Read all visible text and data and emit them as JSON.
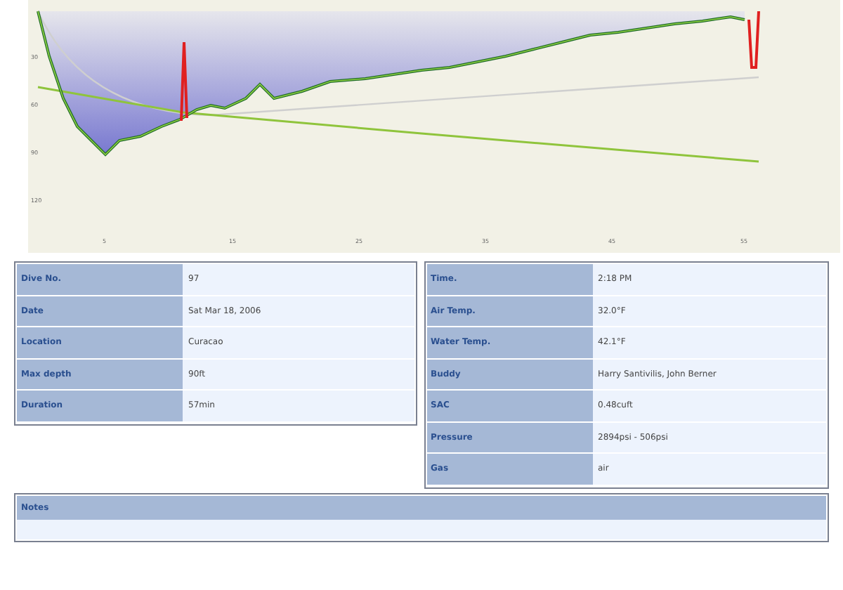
{
  "profile": {
    "y_ticks": [
      "30",
      "60",
      "90",
      "120"
    ],
    "x_ticks": [
      "5",
      "15",
      "25",
      "35",
      "45",
      "55"
    ]
  },
  "left_table": [
    {
      "label": "Dive No.",
      "value": "97"
    },
    {
      "label": "Date",
      "value": "Sat Mar 18, 2006"
    },
    {
      "label": "Location",
      "value": "Curacao"
    },
    {
      "label": "Max depth",
      "value": "90ft"
    },
    {
      "label": "Duration",
      "value": "57min"
    }
  ],
  "right_table": [
    {
      "label": "Time.",
      "value": "2:18 PM"
    },
    {
      "label": "Air Temp.",
      "value": "32.0°F"
    },
    {
      "label": "Water Temp.",
      "value": "42.1°F"
    },
    {
      "label": "Buddy",
      "value": "Harry Santivilis, John Berner"
    },
    {
      "label": "SAC",
      "value": "0.48cuft"
    },
    {
      "label": "Pressure",
      "value": "2894psi - 506psi"
    },
    {
      "label": "Gas",
      "value": "air"
    }
  ],
  "notes": {
    "label": "Notes"
  }
}
